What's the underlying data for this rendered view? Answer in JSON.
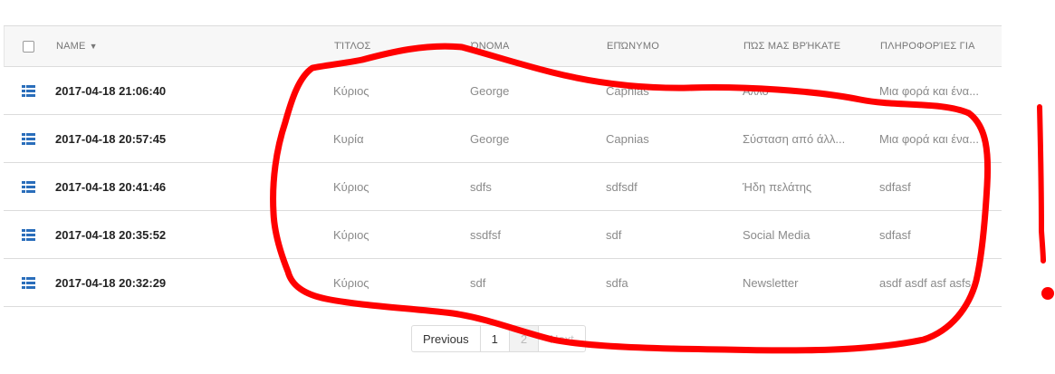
{
  "table": {
    "columns": {
      "name": "NAME",
      "title": "ΤΊΤΛΟΣ",
      "first_name": "ΌΝΟΜΑ",
      "last_name": "ΕΠΏΝΥΜΟ",
      "how_found": "ΠΏΣ ΜΑΣ ΒΡΉΚΑΤΕ",
      "info": "ΠΛΗΡΟΦΟΡΊΕΣ ΓΙΑ"
    },
    "sort_indicator": "▼",
    "rows": [
      {
        "date": "2017-04-18 21:06:40",
        "title": "Κύριος",
        "first_name": "George",
        "last_name": "Capnias",
        "how_found": "Άλλο",
        "info": "Μια φορά και ένα..."
      },
      {
        "date": "2017-04-18 20:57:45",
        "title": "Κυρία",
        "first_name": "George",
        "last_name": "Capnias",
        "how_found": "Σύσταση από άλλ...",
        "info": "Μια φορά και ένα..."
      },
      {
        "date": "2017-04-18 20:41:46",
        "title": "Κύριος",
        "first_name": "sdfs",
        "last_name": "sdfsdf",
        "how_found": "Ήδη πελάτης",
        "info": "sdfasf"
      },
      {
        "date": "2017-04-18 20:35:52",
        "title": "Κύριος",
        "first_name": "ssdfsf",
        "last_name": "sdf",
        "how_found": "Social Media",
        "info": "sdfasf"
      },
      {
        "date": "2017-04-18 20:32:29",
        "title": "Κύριος",
        "first_name": "sdf",
        "last_name": "sdfa",
        "how_found": "Newsletter",
        "info": "asdf asdf asf asfs"
      }
    ]
  },
  "pagination": {
    "previous": "Previous",
    "page1": "1",
    "page2": "2",
    "next": "Next"
  },
  "colors": {
    "row_icon": "#2a6ebb",
    "annotation": "#ff0000"
  }
}
